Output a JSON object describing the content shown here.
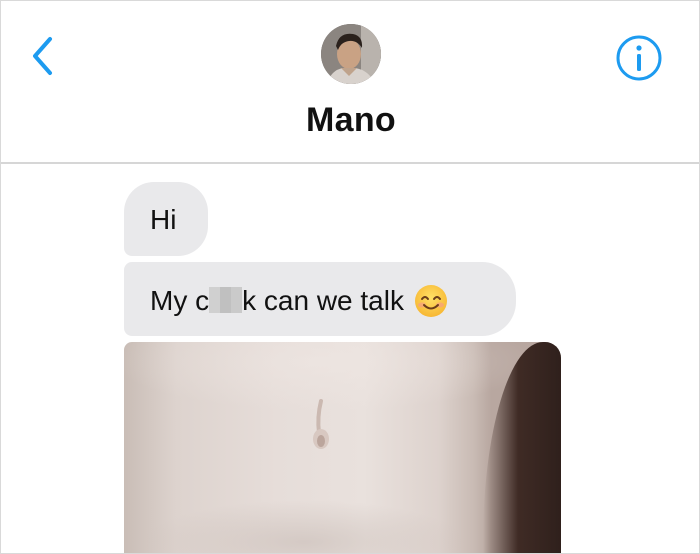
{
  "header": {
    "contact_name": "Mano",
    "back_icon": "chevron-left-icon",
    "info_icon": "info-circle-icon",
    "accent_color": "#1d9bf0"
  },
  "messages": [
    {
      "type": "text",
      "direction": "incoming",
      "text": "Hi"
    },
    {
      "type": "text",
      "direction": "incoming",
      "text_before": "My c",
      "censored": true,
      "text_after": "k can we talk",
      "emoji": "smiling-face-icon"
    },
    {
      "type": "image",
      "direction": "incoming"
    }
  ],
  "colors": {
    "bubble": "#e9e9eb",
    "text": "#111111",
    "divider": "#d6d6d6"
  }
}
